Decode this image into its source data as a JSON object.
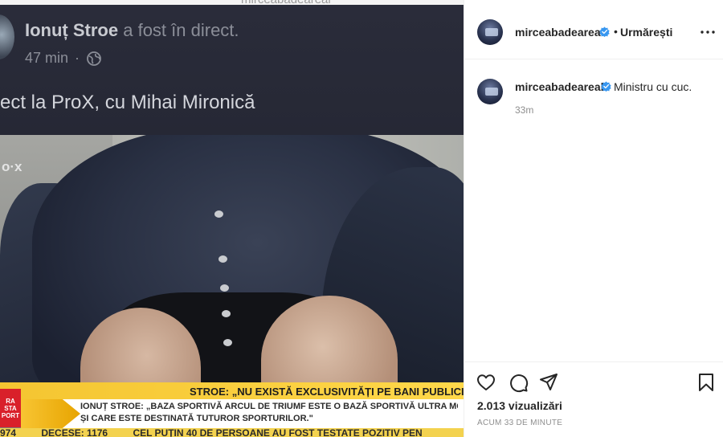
{
  "media": {
    "top_ghost_text": "mirceabadeareal",
    "fb_post": {
      "author": "Ionuț Stroe",
      "action": "a fost în direct.",
      "time": "47 min",
      "text": "ect la ProX, cu Mihai Mironică"
    },
    "video": {
      "corner_logo": "o·x",
      "headline": "STROE: „NU EXISTĂ EXCLUSIVITĂȚI PE BANI PUBLICI\"",
      "subtitle_line1": "IONUȚ STROE: „BAZA SPORTIVĂ ARCUL DE TRIUMF ESTE O BAZĂ SPORTIVĂ ULTRA MODE",
      "subtitle_line2": "ȘI CARE ESTE DESTINATĂ TUTUROR SPORTURILOR.\"",
      "station_badge_top": "RA",
      "station_badge_mid": "STA",
      "station_badge_bottom": "PORT",
      "bottom_ticker": [
        "974",
        "DECESE: 1176",
        "CEL PUȚIN 40 DE PERSOANE AU FOST TESTATE POZITIV PEN"
      ]
    }
  },
  "post_header": {
    "username": "mirceabadeareal",
    "separator": "•",
    "follow_label": "Urmărești",
    "more_icon": "more-horizontal-icon"
  },
  "caption": {
    "username": "mirceabadeareal",
    "text": "Ministru cu cuc.",
    "time": "33m"
  },
  "actions": {
    "icons": [
      "heart-icon",
      "comment-icon",
      "share-icon",
      "save-icon"
    ],
    "views": "2.013 vizualizări",
    "post_age": "ACUM 33 DE MINUTE"
  },
  "colors": {
    "verified": "#3897f0",
    "text_primary": "#262626",
    "text_secondary": "#8e8e8e",
    "divider": "#efefef",
    "ticker_yellow": "#f4c531",
    "station_red": "#d9202a"
  }
}
